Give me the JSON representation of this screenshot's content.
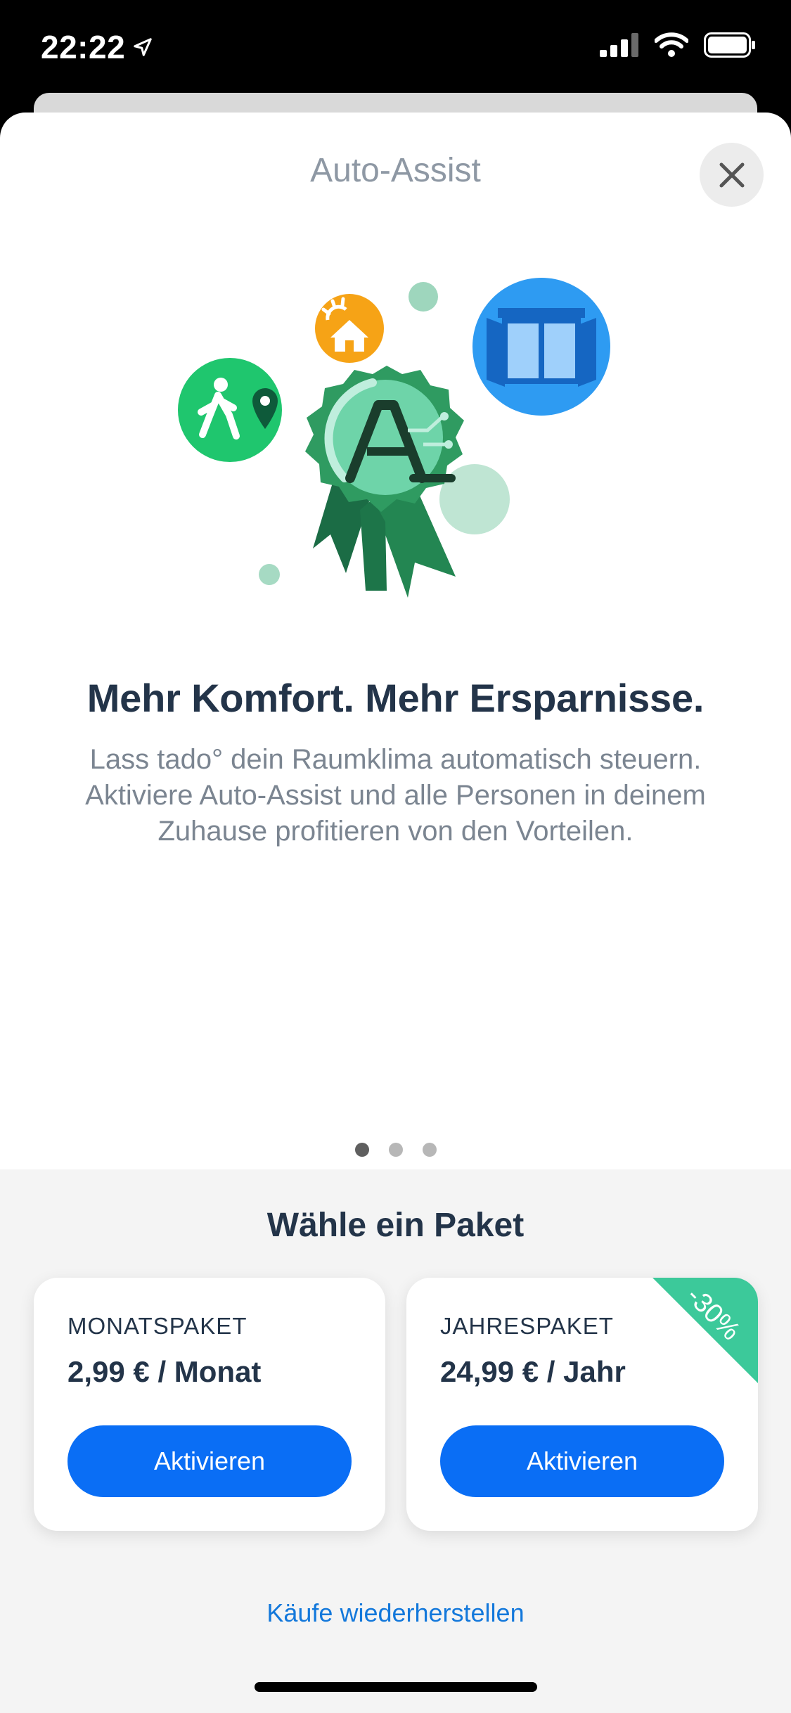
{
  "status_bar": {
    "time": "22:22"
  },
  "modal": {
    "title": "Auto-Assist",
    "close_icon": "close-icon"
  },
  "hero": {
    "headline": "Mehr Komfort. Mehr Ersparnisse.",
    "subtext_lines": [
      "Lass tado° dein Raumklima automatisch steuern.",
      "Aktiviere Auto-Assist und alle Personen in deinem",
      "Zuhause profitieren von den Vorteilen."
    ],
    "page_indicator": {
      "count": 3,
      "active_index": 0
    }
  },
  "plans": {
    "title": "Wähle ein Paket",
    "items": [
      {
        "name": "MONATSPAKET",
        "price": "2,99 € / Monat",
        "button": "Aktivieren"
      },
      {
        "name": "JAHRESPAKET",
        "price": "24,99 € / Jahr",
        "button": "Aktivieren",
        "badge": "-30%"
      }
    ],
    "restore_link": "Käufe wiederherstellen"
  },
  "colors": {
    "accent_blue": "#0a6ef5",
    "link_blue": "#1378db",
    "dark_text": "#233449",
    "muted_text": "#7b8591",
    "discount_green": "#3cc99a"
  }
}
